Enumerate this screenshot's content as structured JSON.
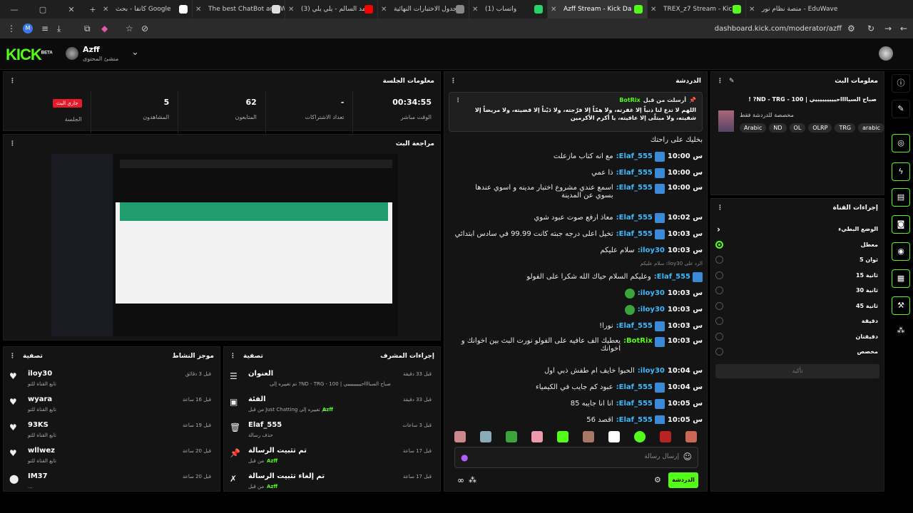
{
  "browser": {
    "tabs": [
      {
        "title": "منصة نظام نور - EduWave"
      },
      {
        "title": "TREX_z7 Stream - Kick"
      },
      {
        "title": "Azff Stream - Kick Da",
        "active": true
      },
      {
        "title": "(1) واتساب"
      },
      {
        "title": "جدول الاختبارات النهائية"
      },
      {
        "title": "(3) محمد السالم - يلي يلي"
      },
      {
        "title": "The best ChatBot and W"
      },
      {
        "title": "كانفا - بحث Google"
      }
    ],
    "url": "dashboard.kick.com/moderator/azff"
  },
  "header": {
    "logo": "KICK",
    "logo_sup": "BETA",
    "channel_name": "Azff",
    "channel_sub": "منشئ المحتوى"
  },
  "session": {
    "title": "معلومات الجلسة",
    "stats": [
      {
        "value": "00:34:55",
        "label": "الوقت مباشر"
      },
      {
        "value": "-",
        "label": "تعداد الاشتراكات"
      },
      {
        "value": "62",
        "label": "المتابعون"
      },
      {
        "value": "5",
        "label": "المشاهدون"
      },
      {
        "value": "جاري البث",
        "label": "الجلسة",
        "badge": true
      }
    ]
  },
  "preview": {
    "title": "مراجعة البث"
  },
  "activity": {
    "title": "موجز النشاط",
    "filter": "تصفية",
    "items": [
      {
        "name": "iloy30",
        "sub": "تابع القناة للتو",
        "time": "قبل 3 دقائق",
        "icon": "heart-icon"
      },
      {
        "name": "wyara",
        "sub": "تابع القناة للتو",
        "time": "قبل 16 ساعة",
        "icon": "heart-icon"
      },
      {
        "name": "93KS",
        "sub": "تابع القناة للتو",
        "time": "قبل 19 ساعة",
        "icon": "heart-icon"
      },
      {
        "name": "wllwez",
        "sub": "تابع القناة للتو",
        "time": "قبل 20 ساعة",
        "icon": "heart-icon"
      },
      {
        "name": "IM37",
        "sub": "...",
        "time": "قبل 20 ساعة",
        "icon": "share-icon"
      }
    ]
  },
  "mod_actions": {
    "title": "إجراءات المشرف",
    "filter": "تصفية",
    "items": [
      {
        "name": "العنوان",
        "sub": "صباح السبااااحيييييييييي | ND - TRG - 100? تم تغييره إلى",
        "who": "Azff",
        "time": "قبل 33 دقيقة",
        "icon": "title-icon"
      },
      {
        "name": "الفئة",
        "sub": "تم تغييره إلى Just Chatting من قبل",
        "who": "Azff",
        "time": "قبل 33 دقيقة",
        "icon": "category-icon"
      },
      {
        "name": "Elaf_555",
        "sub": "حذف رسالة",
        "who": "",
        "time": "قبل 3 ساعات",
        "icon": "trash-icon"
      },
      {
        "name": "تم تثبيت الرسالة",
        "sub": "من قبل",
        "who": "Azff",
        "time": "قبل 17 ساعة",
        "icon": "pin-icon"
      },
      {
        "name": "تم إلغاء تثبيت الرسالة",
        "sub": "من قبل",
        "who": "Azff",
        "time": "قبل 17 ساعة",
        "icon": "unpin-icon"
      }
    ]
  },
  "chat": {
    "title": "الدردشة",
    "pinned": {
      "author": "BotRix",
      "label": "أرسلت من قبل",
      "text": "اللهم لا تدع لنا ذنباً إلا غفرته، ولا همّاً إلا فرّجته، ولا دَيْناً إلا قضيته، ولا مريضاً إلا شفيته، ولا مبتلًى إلا عافيته، يا أكرم الأكرمين"
    },
    "messages": [
      {
        "time": "",
        "user": "",
        "text": "بخليك على راحتك"
      },
      {
        "time": "س 10:00",
        "user": "Elaf_555:",
        "text": "مع انه كتاب مازعلت"
      },
      {
        "time": "س 10:00",
        "user": "Elaf_555:",
        "text": "ذا عمي"
      },
      {
        "time": "س 10:00",
        "user": "Elaf_555:",
        "text": "اسمع عندي مشروع اختبار مدينه و اسوي عندها بسوي عن المدينة"
      },
      {
        "time": "س 10:02",
        "user": "Elaf_555:",
        "text": "معاذ ارفع صوت عبود شوي"
      },
      {
        "time": "س 10:03",
        "user": "Elaf_555:",
        "text": "تخيل اعلى درجه جبته كانت 99.99 في سادس ابتدائي"
      },
      {
        "time": "س 10:03",
        "user": "iloy30:",
        "text": "سلام عليكم"
      },
      {
        "time": "",
        "user": "Elaf_555:",
        "text": "وعليكم السلام حياك الله شكرا على الفولو",
        "reply": "الرد على iloy30: سلام عليكم"
      },
      {
        "time": "س 10:03",
        "user": "iloy30:",
        "text": ""
      },
      {
        "time": "س 10:03",
        "user": "iloy30:",
        "text": ""
      },
      {
        "time": "س 10:03",
        "user": "Elaf_555:",
        "text": "نورا!"
      },
      {
        "time": "س 10:03",
        "user": "BotRix:",
        "text": "يعطيك الف عافيه على الفولو نورت البث بين اخوانك و اخوانك"
      },
      {
        "time": "س 10:04",
        "user": "iloy30:",
        "text": "الحبوا خايف ام طفش ذبي اول"
      },
      {
        "time": "س 10:04",
        "user": "Elaf_555:",
        "text": "عبود كم جايب في الكيمياء"
      },
      {
        "time": "س 10:05",
        "user": "Elaf_555:",
        "text": "انا انا جايبه 85"
      },
      {
        "time": "س 10:05",
        "user": "Elaf_555:",
        "text": "اقصد 56"
      }
    ],
    "input_placeholder": "إرسال رسالة",
    "send_label": "الدردشة"
  },
  "stream_info": {
    "title": "معلومات البث",
    "stream_title": "صباح السبااااحيييييييييي | ND - TRG - 100? !",
    "subtitle": "مخصصة للدردشة فقط",
    "tags": [
      "Arabic",
      "ND",
      "OL",
      "OLRP",
      "TRG",
      "arabic"
    ]
  },
  "channel_actions": {
    "title": "إجراءات القناة",
    "mode_label": "الوضع البطيء",
    "options": [
      "معطل",
      "ثوان 5",
      "ثانية 15",
      "ثانية 30",
      "ثانية 45",
      "دقيقة",
      "دقيقتان",
      "مخصص"
    ],
    "selected": 0,
    "confirm": "تأكيد"
  },
  "colors": {
    "accent": "#53fc18",
    "live": "#e61b2a",
    "username": "#3cb9ff"
  }
}
